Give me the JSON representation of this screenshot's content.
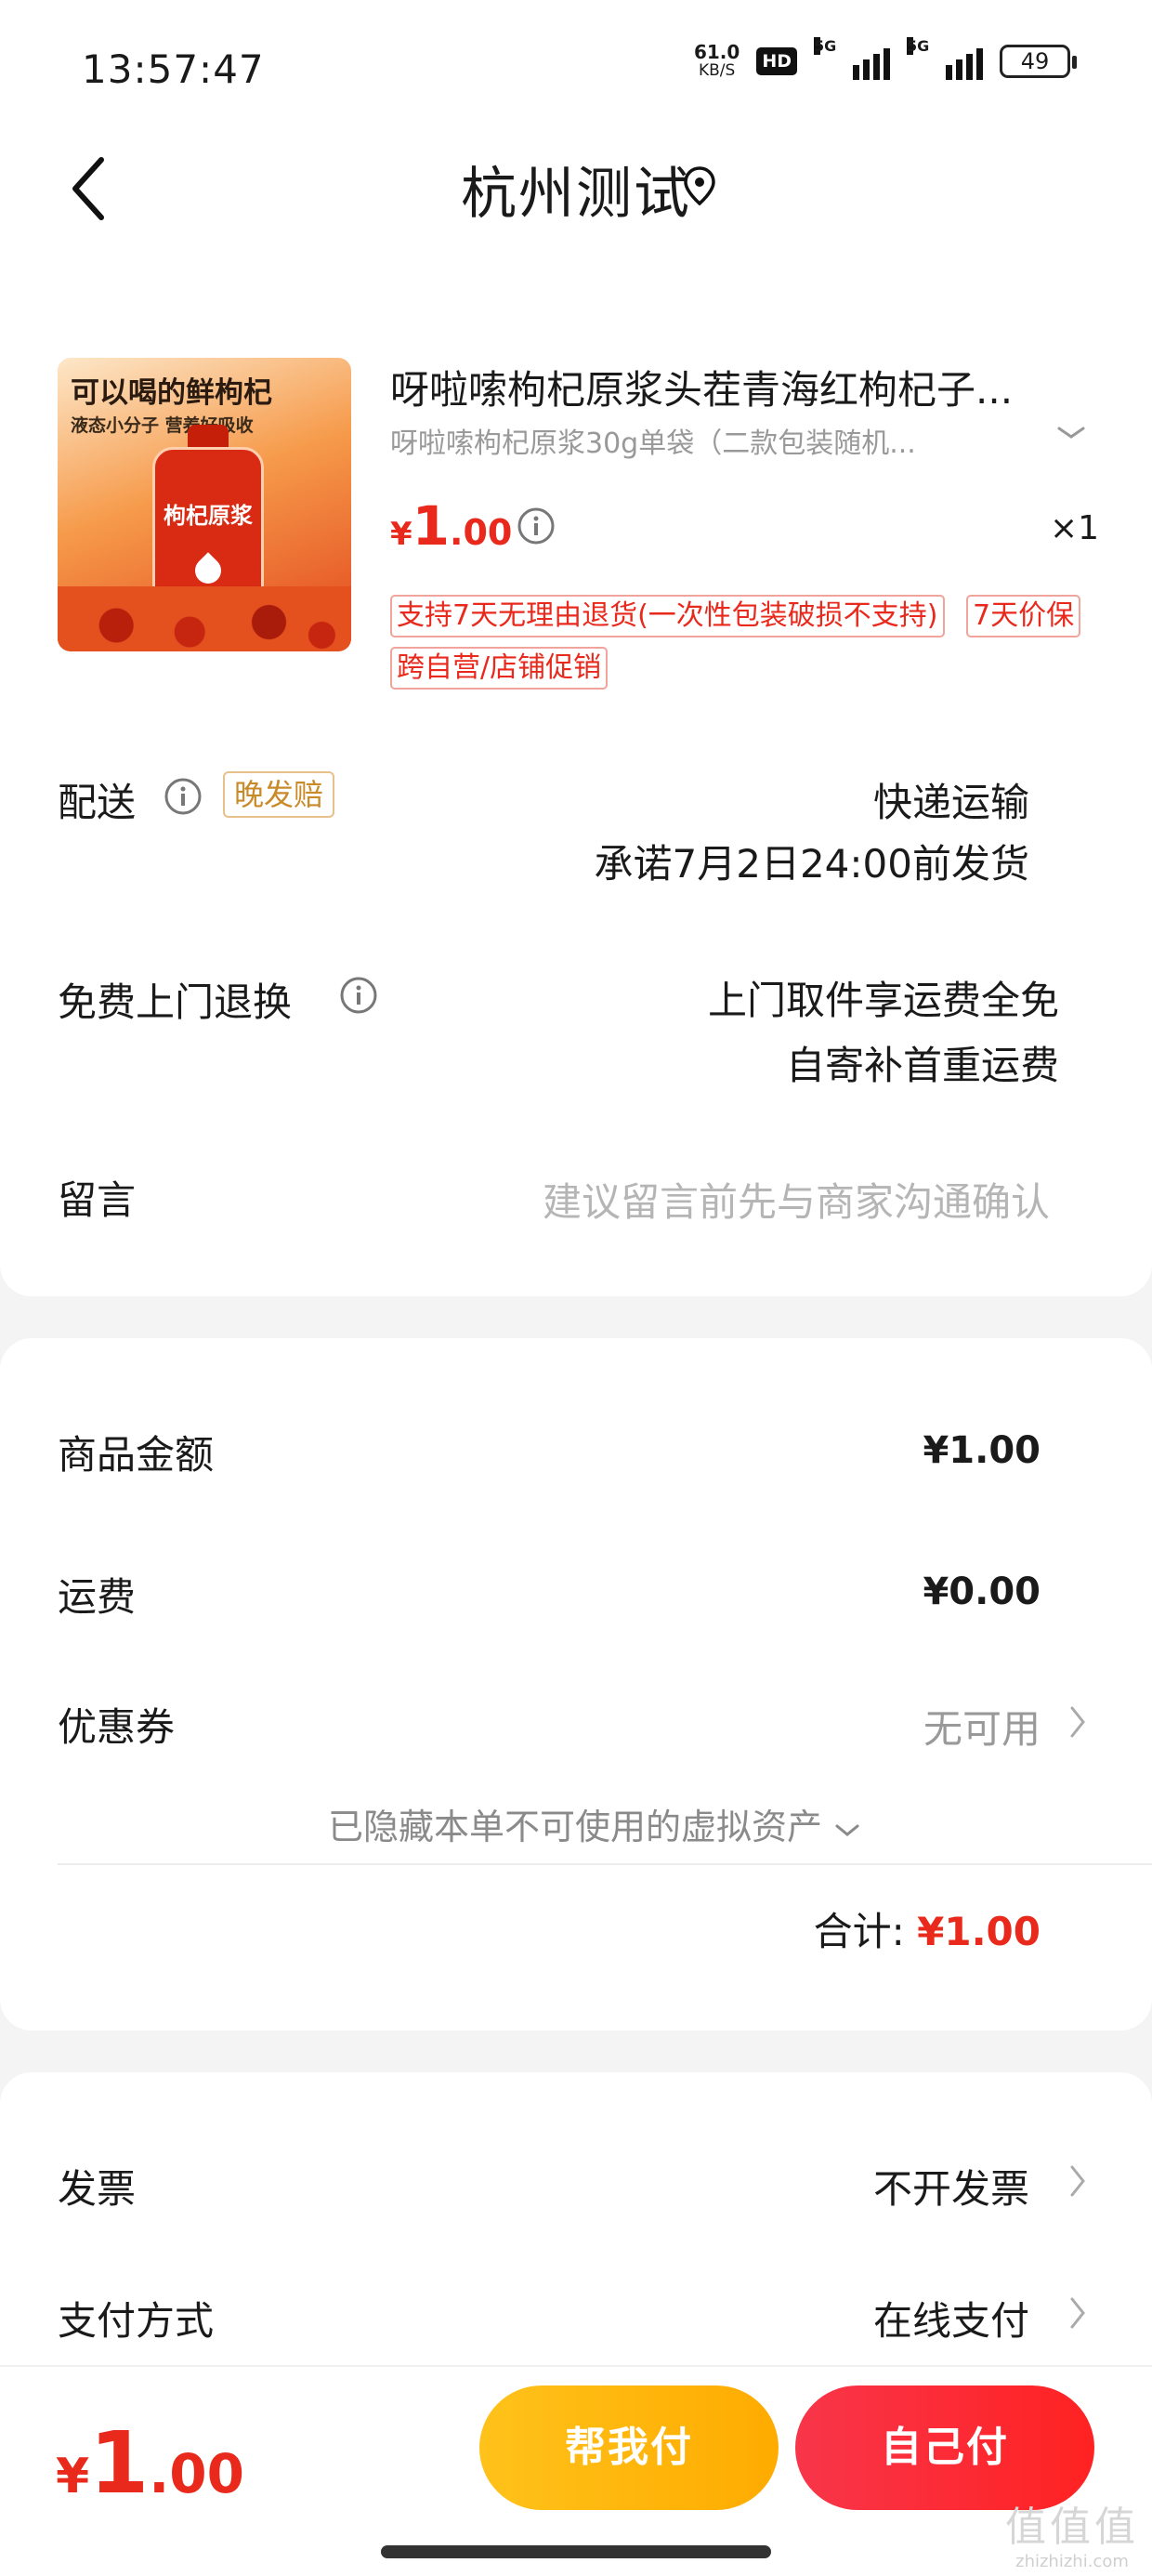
{
  "status_bar": {
    "time": "13:57:47",
    "net_speed": "61.0",
    "net_unit": "KB/S",
    "hd": "HD",
    "signal1": "5G",
    "signal2": "5G",
    "battery": "49"
  },
  "header": {
    "title": "杭州测试"
  },
  "product": {
    "image_text_1": "可以喝的鲜枸杞",
    "image_text_2": "液态小分子 营养好吸收",
    "image_label": "枸杞原浆",
    "title": "呀啦嗦枸杞原浆头茬青海红枸杞子...",
    "spec": "呀啦嗦枸杞原浆30g单袋（二款包装随机...",
    "price_symbol": "¥",
    "price_int": "1",
    "price_dec": ".00",
    "quantity": "×1",
    "tags": [
      "支持7天无理由退货(一次性包装破损不支持)",
      "7天价保",
      "跨自营/店铺促销"
    ]
  },
  "delivery": {
    "label": "配送",
    "badge": "晚发赔",
    "method": "快递运输",
    "promise": "承诺7月2日24:00前发货"
  },
  "return_service": {
    "label": "免费上门退换",
    "line1": "上门取件享运费全免",
    "line2": "自寄补首重运费"
  },
  "message": {
    "label": "留言",
    "placeholder": "建议留言前先与商家沟通确认"
  },
  "summary": {
    "goods_label": "商品金额",
    "goods_value": "¥1.00",
    "shipping_label": "运费",
    "shipping_value": "¥0.00",
    "coupon_label": "优惠券",
    "coupon_value": "无可用",
    "hidden_assets": "已隐藏本单不可使用的虚拟资产",
    "total_label": "合计:",
    "total_value": "¥1.00"
  },
  "invoice": {
    "label": "发票",
    "value": "不开发票"
  },
  "payment": {
    "label": "支付方式",
    "value": "在线支付"
  },
  "bottom": {
    "price_symbol": "¥",
    "price_int": "1",
    "price_dec": ".00",
    "help_pay": "帮我付",
    "self_pay": "自己付"
  },
  "watermark": {
    "big": "值值值",
    "small": "zhizhizhi.com"
  },
  "colors": {
    "accent_red": "#e8291c",
    "help_btn": "#ffb300",
    "self_btn": "#f8354a"
  }
}
